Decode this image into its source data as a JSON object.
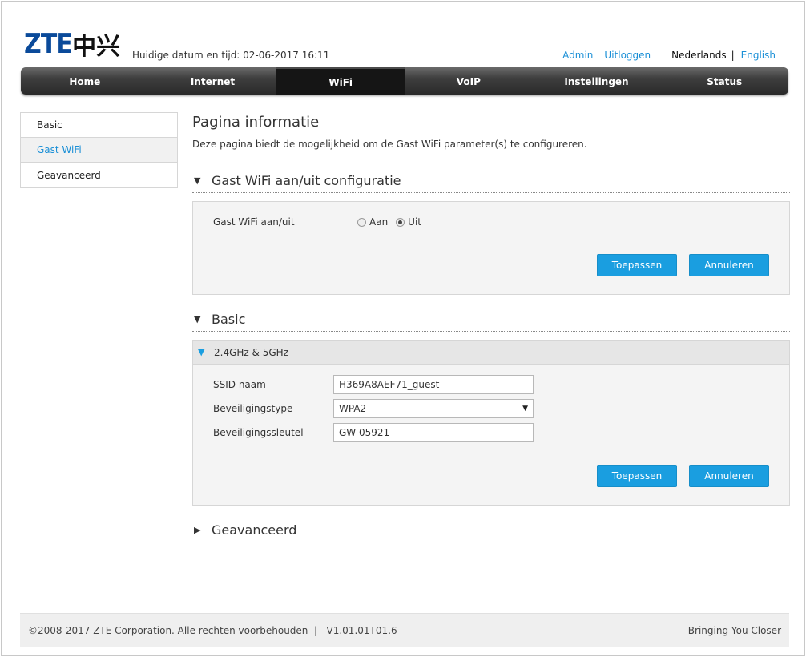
{
  "header": {
    "logo_latin": "ZTE",
    "logo_cjk": "中兴",
    "datetime": "Huidige datum en tijd: 02-06-2017 16:11",
    "admin": "Admin",
    "logout": "Uitloggen",
    "lang_nl": "Nederlands",
    "lang_sep": "|",
    "lang_en": "English"
  },
  "nav": {
    "items": [
      {
        "label": "Home"
      },
      {
        "label": "Internet"
      },
      {
        "label": "WiFi",
        "active": true
      },
      {
        "label": "VoIP"
      },
      {
        "label": "Instellingen"
      },
      {
        "label": "Status"
      }
    ]
  },
  "sidebar": {
    "items": [
      {
        "label": "Basic"
      },
      {
        "label": "Gast WiFi",
        "active": true
      },
      {
        "label": "Geavanceerd"
      }
    ]
  },
  "main": {
    "title": "Pagina informatie",
    "description": "Deze pagina biedt de mogelijkheid om de Gast WiFi parameter(s) te configureren.",
    "section_onoff": {
      "title": "Gast WiFi aan/uit configuratie",
      "label": "Gast WiFi aan/uit",
      "option_on": "Aan",
      "option_off": "Uit",
      "selected": "Uit",
      "apply": "Toepassen",
      "cancel": "Annuleren"
    },
    "section_basic": {
      "title": "Basic",
      "band": "2.4GHz & 5GHz",
      "ssid_label": "SSID naam",
      "ssid_value": "H369A8AEF71_guest",
      "security_label": "Beveiligingstype",
      "security_value": "WPA2",
      "key_label": "Beveiligingssleutel",
      "key_value": "GW-05921",
      "apply": "Toepassen",
      "cancel": "Annuleren"
    },
    "section_advanced": {
      "title": "Geavanceerd"
    }
  },
  "footer": {
    "copyright": "©2008-2017 ZTE Corporation. Alle rechten voorbehouden  |   V1.01.01T01.6",
    "slogan": "Bringing You Closer"
  },
  "colors": {
    "accent": "#1a9ee0",
    "link": "#1a8fd6",
    "brand_blue": "#0a4a9a"
  }
}
